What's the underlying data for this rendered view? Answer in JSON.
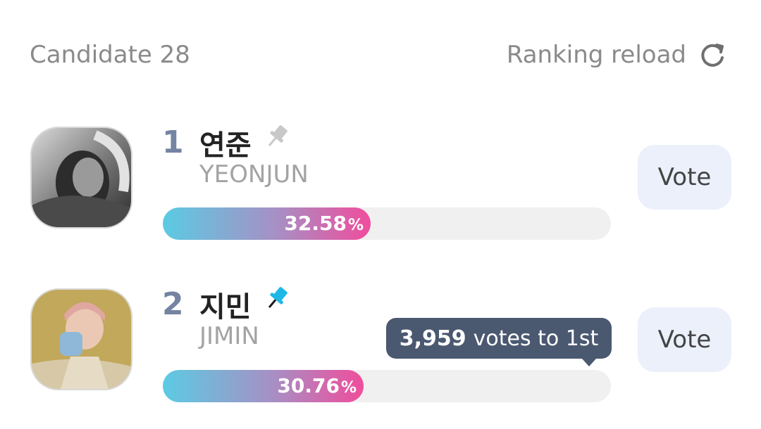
{
  "header": {
    "candidate_label": "Candidate 28",
    "reload_label": "Ranking reload",
    "reload_icon": "refresh-icon"
  },
  "candidates": [
    {
      "rank": "1",
      "name_ko": "연준",
      "name_en": "YEONJUN",
      "percent": "32.58",
      "percent_unit": "%",
      "percent_value": 32.58,
      "pinned": false,
      "vote_label": "Vote"
    },
    {
      "rank": "2",
      "name_ko": "지민",
      "name_en": "JIMIN",
      "percent": "30.76",
      "percent_unit": "%",
      "percent_value": 30.76,
      "pinned": true,
      "vote_label": "Vote"
    }
  ],
  "tooltip": {
    "count": "3,959",
    "text": "votes to 1st"
  },
  "colors": {
    "rank": "#7484a2",
    "pin_inactive": "#c8c8c8",
    "pin_active": "#1fb8e6",
    "bar_start": "#5bcbe3",
    "bar_end": "#f04d9c",
    "vote_button_bg": "#ebf0fb",
    "tooltip_bg": "#4a5870"
  }
}
